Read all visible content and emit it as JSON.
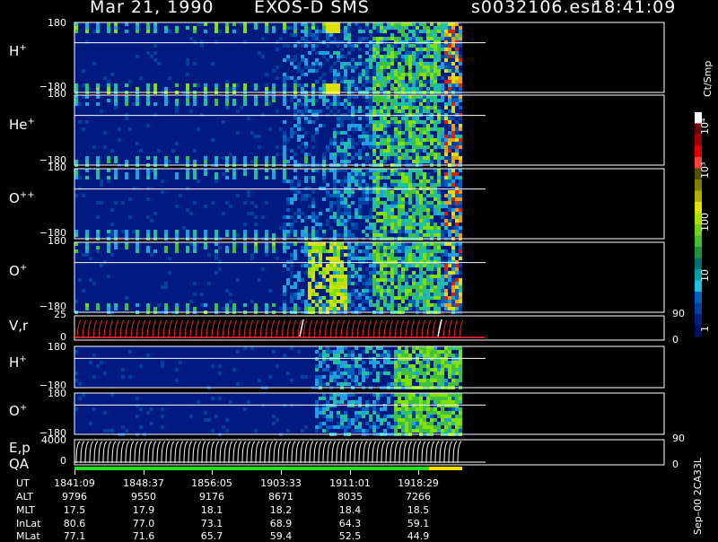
{
  "header": {
    "date": "Mar 21, 1990",
    "instrument": "EXOS-D SMS",
    "file": "s0032106.esr",
    "time": "18:41:09"
  },
  "panels": [
    {
      "id": "h-plus",
      "label": "H",
      "sup": "+",
      "top_tick": "180",
      "bot_tick": "−180"
    },
    {
      "id": "he-plus",
      "label": "He",
      "sup": "+",
      "top_tick": "180",
      "bot_tick": "−180"
    },
    {
      "id": "o-plus-plus",
      "label": "O",
      "sup": "++",
      "top_tick": "180",
      "bot_tick": "−180"
    },
    {
      "id": "o-plus",
      "label": "O",
      "sup": "+",
      "top_tick": "180",
      "bot_tick": "−180"
    },
    {
      "id": "vr",
      "label": "V,r",
      "sup": "",
      "top_tick": "25",
      "bot_tick": "0",
      "rtop": "90",
      "rbot": "0"
    },
    {
      "id": "h-plus-2",
      "label": "H",
      "sup": "+",
      "top_tick": "180",
      "bot_tick": "−180"
    },
    {
      "id": "o-plus-2",
      "label": "O",
      "sup": "+",
      "top_tick": "180",
      "bot_tick": "−180"
    },
    {
      "id": "ep",
      "label": "E,p",
      "sup": "",
      "top_tick": "4000",
      "bot_tick": "0",
      "rtop": "90",
      "rbot": "0"
    }
  ],
  "qa_label": "QA",
  "colorbar": {
    "unit": "Ct/Smp",
    "ticks": [
      "10⁴",
      "10³",
      "100",
      "10",
      "1"
    ],
    "colors": [
      "#ffffff",
      "#6e0000",
      "#a00000",
      "#e00000",
      "#ff4040",
      "#505000",
      "#808000",
      "#b0b000",
      "#e0e000",
      "#a8e000",
      "#70d020",
      "#40c030",
      "#209040",
      "#007070",
      "#00a0a0",
      "#20c0e0",
      "#0060c0",
      "#0040a0",
      "#002080",
      "#001060"
    ]
  },
  "footer_note": "Sep–00  2CA33L",
  "table": {
    "row_labels": [
      "UT",
      "ALT",
      "MLT",
      "InLat",
      "MLat"
    ],
    "columns": [
      [
        "1841:09",
        "9796",
        "17.5",
        "80.6",
        "77.1"
      ],
      [
        "1848:37",
        "9550",
        "17.9",
        "77.0",
        "71.6"
      ],
      [
        "1856:05",
        "9176",
        "18.1",
        "73.1",
        "65.7"
      ],
      [
        "1903:33",
        "8671",
        "18.2",
        "68.9",
        "59.4"
      ],
      [
        "1911:01",
        "8035",
        "18.4",
        "64.3",
        "52.5"
      ],
      [
        "1918:29",
        "7266",
        "18.5",
        "59.1",
        "44.9"
      ]
    ]
  },
  "chart_data": {
    "type": "heatmap",
    "title": "Mar 21, 1990   EXOS-D SMS",
    "x_ticks": [
      "1841:09",
      "1848:37",
      "1856:05",
      "1903:33",
      "1911:01",
      "1918:29"
    ],
    "panels": [
      "H+",
      "He+",
      "O++",
      "O+",
      "V,r",
      "H+",
      "O+",
      "E,p"
    ],
    "y_range_pitch": [
      -180,
      180
    ],
    "colorbar_range": [
      1,
      10000
    ],
    "log_scale": true
  }
}
